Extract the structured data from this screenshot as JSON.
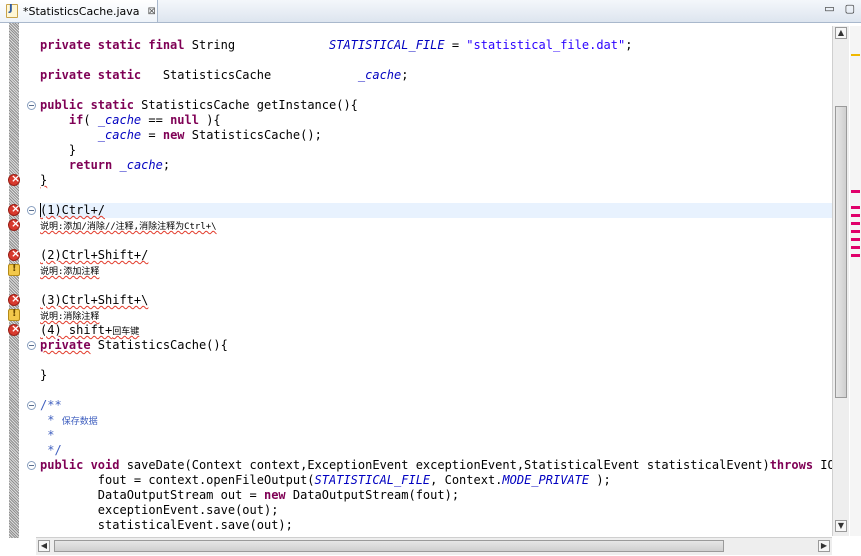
{
  "tab": {
    "title": "*StatisticsCache.java",
    "close_glyph": "⊠",
    "icon": "java-file-icon"
  },
  "window": {
    "minimize_glyph": "▭",
    "maximize_glyph": "▢"
  },
  "code_lines": [
    {
      "parts": [
        [
          "kw",
          "private static final "
        ],
        [
          "",
          "String             "
        ],
        [
          "fld",
          "STATISTICAL_FILE"
        ],
        [
          "",
          " = "
        ],
        [
          "str",
          "\"statistical_file.dat\""
        ],
        [
          "",
          ";"
        ]
      ]
    },
    {
      "parts": []
    },
    {
      "parts": [
        [
          "kw",
          "private static   "
        ],
        [
          "",
          "StatisticsCache            "
        ],
        [
          "fld",
          "_cache"
        ],
        [
          "",
          ";"
        ]
      ]
    },
    {
      "parts": []
    },
    {
      "parts": [
        [
          "kw",
          "public static "
        ],
        [
          "",
          "StatisticsCache getInstance(){"
        ]
      ]
    },
    {
      "parts": [
        [
          "",
          "    "
        ],
        [
          "kw",
          "if"
        ],
        [
          "",
          "( "
        ],
        [
          "fld",
          "_cache"
        ],
        [
          "",
          " == "
        ],
        [
          "kw",
          "null"
        ],
        [
          "",
          " ){"
        ]
      ]
    },
    {
      "parts": [
        [
          "",
          "        "
        ],
        [
          "fld",
          "_cache"
        ],
        [
          "",
          " = "
        ],
        [
          "kw",
          "new"
        ],
        [
          "",
          " StatisticsCache();"
        ]
      ]
    },
    {
      "parts": [
        [
          "",
          "    }"
        ]
      ]
    },
    {
      "parts": [
        [
          "",
          "    "
        ],
        [
          "kw",
          "return"
        ],
        [
          "",
          " "
        ],
        [
          "fld",
          "_cache"
        ],
        [
          "",
          ";"
        ]
      ]
    },
    {
      "parts": [
        [
          "sq",
          "}"
        ]
      ]
    },
    {
      "parts": []
    },
    {
      "parts": [
        [
          "sq",
          "(1)Ctrl+/"
        ]
      ],
      "current": true
    },
    {
      "parts": [
        [
          "sq small",
          "说明:添加/消除//注释,消除注释为Ctrl+\\"
        ]
      ]
    },
    {
      "parts": []
    },
    {
      "parts": [
        [
          "sq",
          "(2)Ctrl+Shift+/"
        ]
      ]
    },
    {
      "parts": [
        [
          "sq small",
          "说明:添加注释"
        ]
      ]
    },
    {
      "parts": []
    },
    {
      "parts": [
        [
          "sq",
          "(3)Ctrl+Shift+\\"
        ]
      ]
    },
    {
      "parts": [
        [
          "sq small",
          "说明:消除注释"
        ]
      ]
    },
    {
      "parts": [
        [
          "sq",
          "(4) shift+"
        ],
        [
          "sq small",
          "回车键"
        ]
      ]
    },
    {
      "parts": [
        [
          "sq kw",
          "private"
        ],
        [
          "",
          " StatisticsCache(){"
        ]
      ]
    },
    {
      "parts": []
    },
    {
      "parts": [
        [
          "",
          "}"
        ]
      ]
    },
    {
      "parts": []
    },
    {
      "parts": [
        [
          "cmt",
          "/**"
        ]
      ]
    },
    {
      "parts": [
        [
          "cmt",
          " * "
        ],
        [
          "cmt small",
          "保存数据"
        ]
      ]
    },
    {
      "parts": [
        [
          "cmt",
          " *"
        ]
      ]
    },
    {
      "parts": [
        [
          "cmt",
          " */"
        ]
      ]
    },
    {
      "parts": [
        [
          "kw",
          "public void "
        ],
        [
          "",
          "saveDate(Context context,ExceptionEvent exceptionEvent,StatisticalEvent statisticalEvent)"
        ],
        [
          "kw",
          "throws"
        ],
        [
          "",
          " IO"
        ]
      ]
    },
    {
      "parts": [
        [
          "",
          "        fout = context.openFileOutput("
        ],
        [
          "fld",
          "STATISTICAL_FILE"
        ],
        [
          "",
          ", Context."
        ],
        [
          "fld",
          "MODE_PRIVATE"
        ],
        [
          "",
          " );"
        ]
      ]
    },
    {
      "parts": [
        [
          "",
          "        DataOutputStream out = "
        ],
        [
          "kw",
          "new"
        ],
        [
          "",
          " DataOutputStream(fout);"
        ]
      ]
    },
    {
      "parts": [
        [
          "",
          "        exceptionEvent.save(out);"
        ]
      ]
    },
    {
      "parts": [
        [
          "",
          "        statisticalEvent.save(out);"
        ]
      ]
    }
  ],
  "gutter": {
    "error_lines": [
      9,
      11,
      12,
      14,
      17,
      19
    ],
    "warning_lines": [
      15,
      18
    ],
    "fold_lines": [
      4,
      11,
      20,
      24,
      28
    ]
  },
  "scroll": {
    "up_glyph": "▲",
    "down_glyph": "▼",
    "left_glyph": "◀",
    "right_glyph": "▶"
  },
  "colors": {
    "keyword": "#7f0055",
    "field": "#0000c0",
    "string": "#2a00ff",
    "comment": "#3f5fbf",
    "error": "#d83a2e",
    "current_line": "#e8f2fe"
  }
}
